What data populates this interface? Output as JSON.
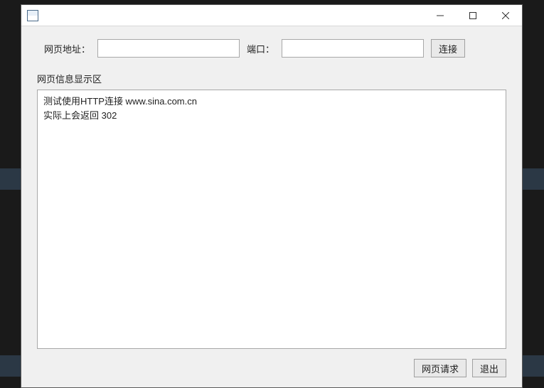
{
  "window": {
    "title": ""
  },
  "form": {
    "url_label": "网页地址：",
    "url_value": "",
    "url_placeholder": "",
    "port_label": "端口：",
    "port_value": "",
    "port_placeholder": "",
    "connect_label": "连接"
  },
  "display": {
    "section_label": "网页信息显示区",
    "content": "测试使用HTTP连接 www.sina.com.cn\n实际上会返回 302"
  },
  "footer": {
    "request_label": "网页请求",
    "exit_label": "退出"
  }
}
